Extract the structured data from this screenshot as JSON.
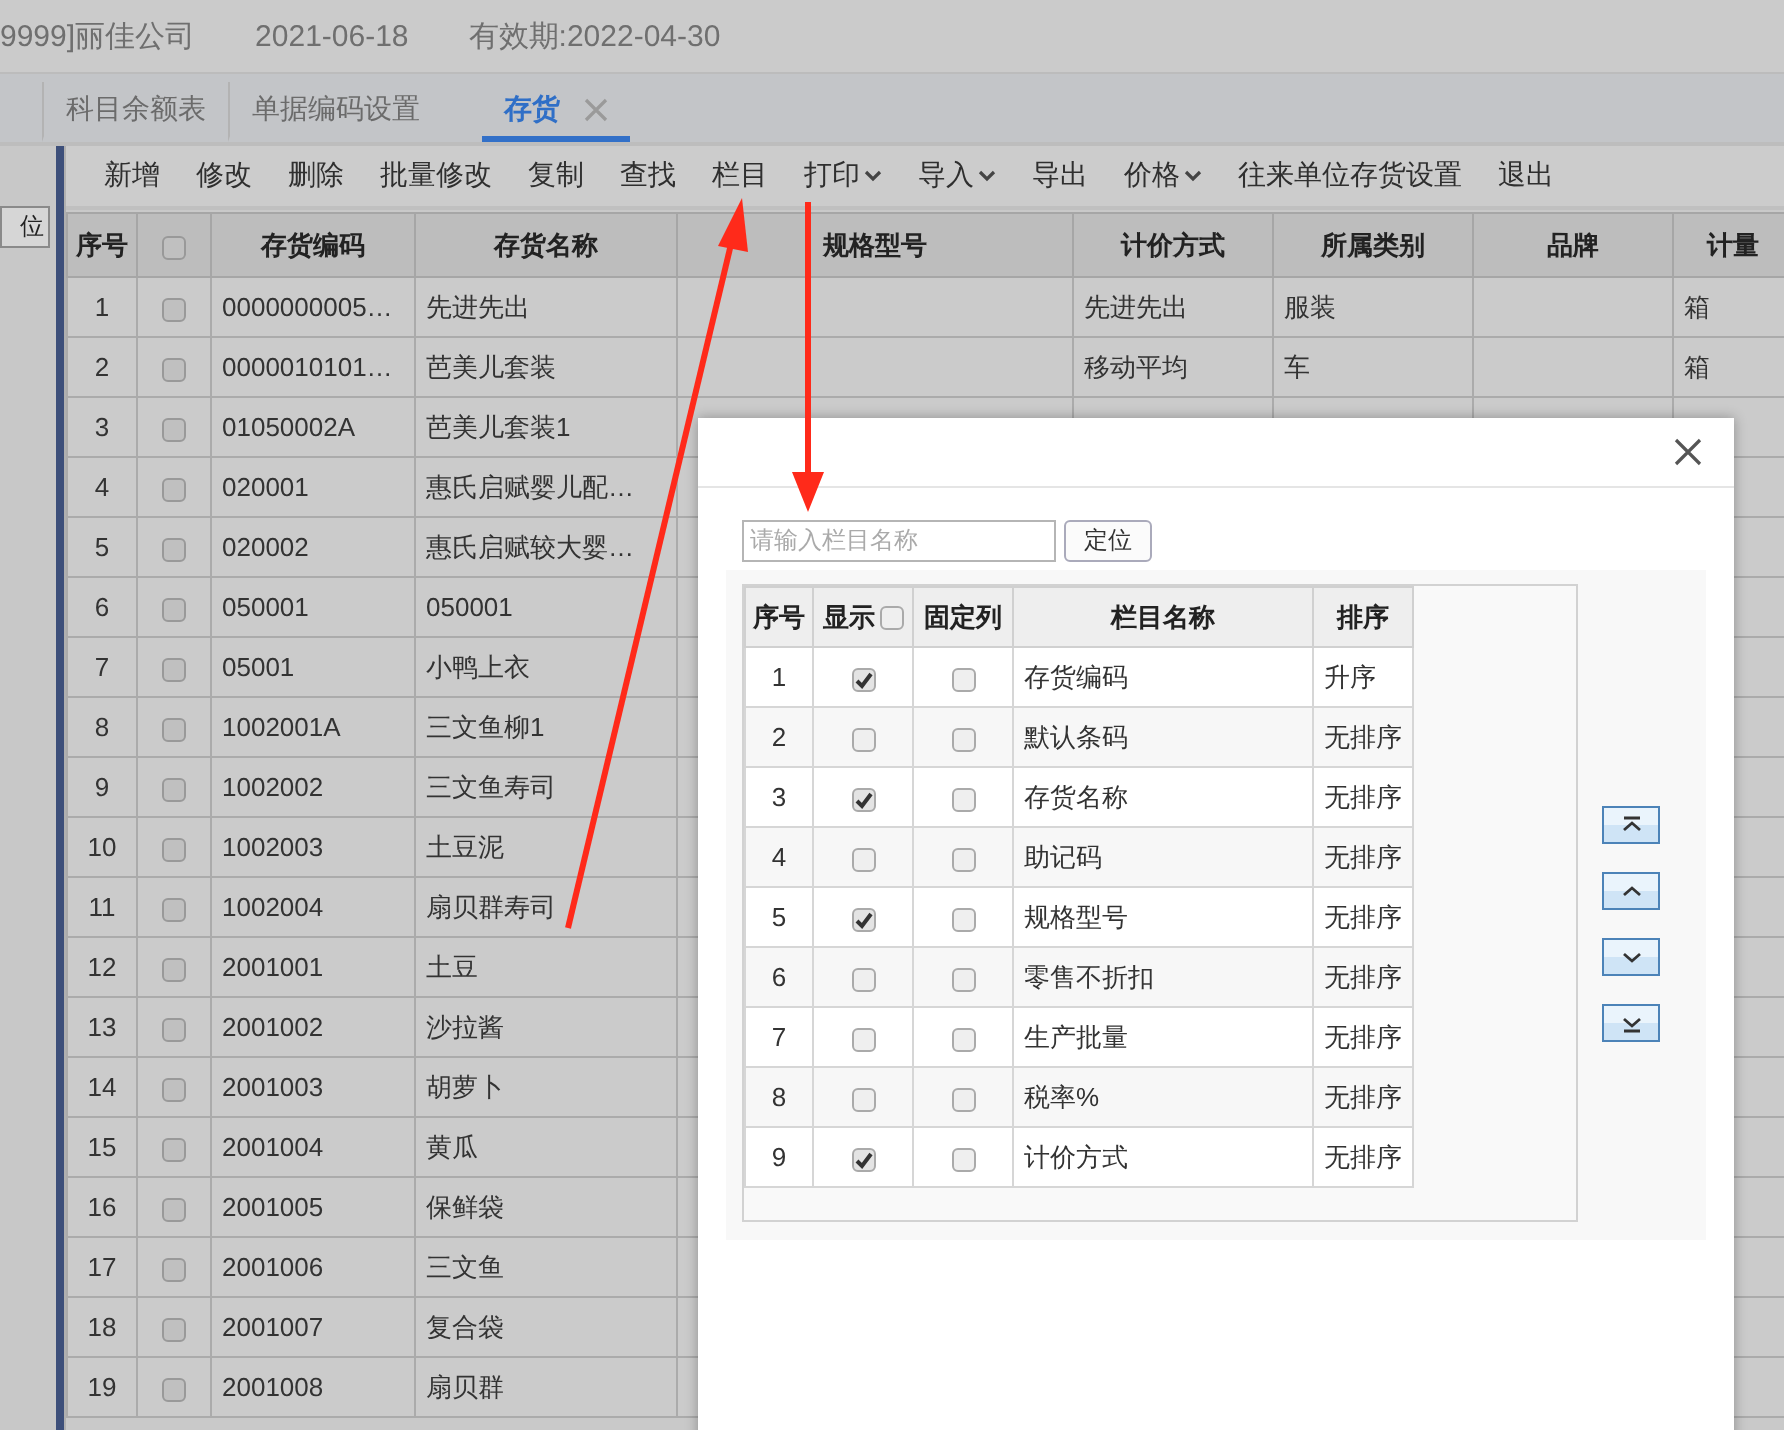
{
  "header": {
    "company": "9999]丽佳公司",
    "date": "2021-06-18",
    "validity": "有效期:2022-04-30"
  },
  "tabs": [
    {
      "label": "科目余额表",
      "selected": false,
      "closable": false
    },
    {
      "label": "单据编码设置",
      "selected": false,
      "closable": false
    },
    {
      "label": "存货",
      "selected": true,
      "closable": true
    }
  ],
  "sidebar": {
    "button": "位"
  },
  "toolbar": [
    {
      "label": "新增",
      "dropdown": false
    },
    {
      "label": "修改",
      "dropdown": false
    },
    {
      "label": "删除",
      "dropdown": false
    },
    {
      "label": "批量修改",
      "dropdown": false
    },
    {
      "label": "复制",
      "dropdown": false
    },
    {
      "label": "查找",
      "dropdown": false
    },
    {
      "label": "栏目",
      "dropdown": false
    },
    {
      "label": "打印",
      "dropdown": true
    },
    {
      "label": "导入",
      "dropdown": true
    },
    {
      "label": "导出",
      "dropdown": false
    },
    {
      "label": "价格",
      "dropdown": true
    },
    {
      "label": "往来单位存货设置",
      "dropdown": false
    },
    {
      "label": "退出",
      "dropdown": false
    }
  ],
  "table": {
    "index_header": "序号",
    "columns": [
      "存货编码",
      "存货名称",
      "规格型号",
      "计价方式",
      "所属类别",
      "品牌",
      "计量"
    ],
    "all_checked": false,
    "rows": [
      {
        "index": "1",
        "checked": false,
        "cells": [
          "0000000005…",
          "先进先出",
          "",
          "先进先出",
          "服装",
          "",
          "箱"
        ]
      },
      {
        "index": "2",
        "checked": false,
        "cells": [
          "0000010101…",
          "芭美儿套装",
          "",
          "移动平均",
          "车",
          "",
          "箱"
        ]
      },
      {
        "index": "3",
        "checked": false,
        "cells": [
          "01050002A",
          "芭美儿套装1",
          "",
          "",
          "",
          "",
          ""
        ]
      },
      {
        "index": "4",
        "checked": false,
        "cells": [
          "020001",
          "惠氏启赋婴儿配…",
          "",
          "",
          "",
          "",
          ""
        ]
      },
      {
        "index": "5",
        "checked": false,
        "cells": [
          "020002",
          "惠氏启赋较大婴…",
          "",
          "",
          "",
          "",
          ""
        ]
      },
      {
        "index": "6",
        "checked": false,
        "cells": [
          "050001",
          "050001",
          "",
          "",
          "",
          "",
          ""
        ]
      },
      {
        "index": "7",
        "checked": false,
        "cells": [
          "05001",
          "小鸭上衣",
          "",
          "",
          "",
          "",
          ""
        ]
      },
      {
        "index": "8",
        "checked": false,
        "cells": [
          "1002001A",
          "三文鱼柳1",
          "",
          "",
          "",
          "",
          ""
        ]
      },
      {
        "index": "9",
        "checked": false,
        "cells": [
          "1002002",
          "三文鱼寿司",
          "",
          "",
          "",
          "",
          ""
        ]
      },
      {
        "index": "10",
        "checked": false,
        "cells": [
          "1002003",
          "土豆泥",
          "",
          "",
          "",
          "",
          ""
        ]
      },
      {
        "index": "11",
        "checked": false,
        "cells": [
          "1002004",
          "扇贝群寿司",
          "",
          "",
          "",
          "",
          ""
        ]
      },
      {
        "index": "12",
        "checked": false,
        "cells": [
          "2001001",
          "土豆",
          "",
          "",
          "",
          "",
          ""
        ]
      },
      {
        "index": "13",
        "checked": false,
        "cells": [
          "2001002",
          "沙拉酱",
          "",
          "",
          "",
          "",
          ""
        ]
      },
      {
        "index": "14",
        "checked": false,
        "cells": [
          "2001003",
          "胡萝卜",
          "",
          "",
          "",
          "",
          ""
        ]
      },
      {
        "index": "15",
        "checked": false,
        "cells": [
          "2001004",
          "黄瓜",
          "",
          "",
          "",
          "",
          ""
        ]
      },
      {
        "index": "16",
        "checked": false,
        "cells": [
          "2001005",
          "保鲜袋",
          "",
          "",
          "",
          "",
          ""
        ]
      },
      {
        "index": "17",
        "checked": false,
        "cells": [
          "2001006",
          "三文鱼",
          "",
          "",
          "",
          "",
          ""
        ]
      },
      {
        "index": "18",
        "checked": false,
        "cells": [
          "2001007",
          "复合袋",
          "",
          "",
          "",
          "",
          ""
        ]
      },
      {
        "index": "19",
        "checked": false,
        "cells": [
          "2001008",
          "扇贝群",
          "",
          "",
          "",
          "",
          ""
        ]
      }
    ]
  },
  "dialog": {
    "search": {
      "placeholder": "请输入栏目名称"
    },
    "locate_button": "定位",
    "columns": [
      "序号",
      "显示",
      "固定列",
      "栏目名称",
      "排序"
    ],
    "show_all_checked": false,
    "rows": [
      {
        "index": "1",
        "show": true,
        "fixed": false,
        "name": "存货编码",
        "sort": "升序"
      },
      {
        "index": "2",
        "show": false,
        "fixed": false,
        "name": "默认条码",
        "sort": "无排序"
      },
      {
        "index": "3",
        "show": true,
        "fixed": false,
        "name": "存货名称",
        "sort": "无排序"
      },
      {
        "index": "4",
        "show": false,
        "fixed": false,
        "name": "助记码",
        "sort": "无排序"
      },
      {
        "index": "5",
        "show": true,
        "fixed": false,
        "name": "规格型号",
        "sort": "无排序"
      },
      {
        "index": "6",
        "show": false,
        "fixed": false,
        "name": "零售不折扣",
        "sort": "无排序"
      },
      {
        "index": "7",
        "show": false,
        "fixed": false,
        "name": "生产批量",
        "sort": "无排序"
      },
      {
        "index": "8",
        "show": false,
        "fixed": false,
        "name": "税率%",
        "sort": "无排序"
      },
      {
        "index": "9",
        "show": true,
        "fixed": false,
        "name": "计价方式",
        "sort": "无排序"
      }
    ],
    "move_buttons": [
      {
        "kind": "top"
      },
      {
        "kind": "up"
      },
      {
        "kind": "down"
      },
      {
        "kind": "bottom"
      }
    ]
  }
}
